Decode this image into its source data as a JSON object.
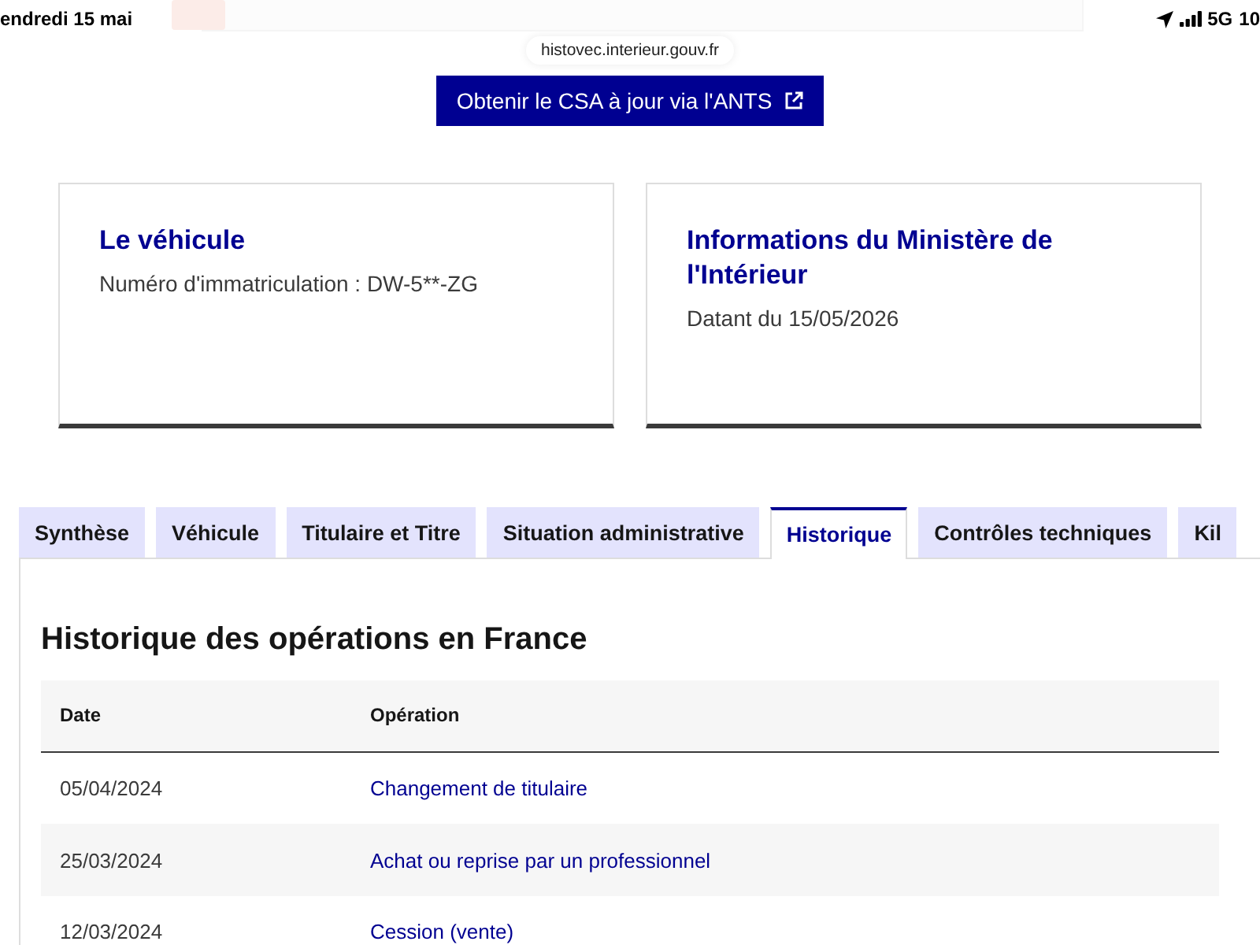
{
  "status_bar": {
    "date": "endredi 15 mai",
    "network": "5G",
    "battery": "10"
  },
  "address_bar": {
    "url": "histovec.interieur.gouv.fr"
  },
  "csa_button": {
    "label": "Obtenir le CSA à jour via l'ANTS"
  },
  "cards": [
    {
      "title": "Le véhicule",
      "text": "Numéro d'immatriculation : DW-5**-ZG"
    },
    {
      "title": "Informations du Ministère de l'Intérieur",
      "text": "Datant du 15/05/2026"
    }
  ],
  "tabs": [
    {
      "label": "Synthèse",
      "selected": false
    },
    {
      "label": "Véhicule",
      "selected": false
    },
    {
      "label": "Titulaire et Titre",
      "selected": false
    },
    {
      "label": "Situation administrative",
      "selected": false
    },
    {
      "label": "Historique",
      "selected": true
    },
    {
      "label": "Contrôles techniques",
      "selected": false
    },
    {
      "label": "Kil",
      "selected": false
    }
  ],
  "history": {
    "title": "Historique des opérations en France",
    "columns": [
      "Date",
      "Opération"
    ],
    "rows": [
      {
        "date": "05/04/2024",
        "operation": "Changement de titulaire"
      },
      {
        "date": "25/03/2024",
        "operation": "Achat ou reprise par un professionnel"
      },
      {
        "date": "12/03/2024",
        "operation": "Cession (vente)"
      }
    ]
  }
}
